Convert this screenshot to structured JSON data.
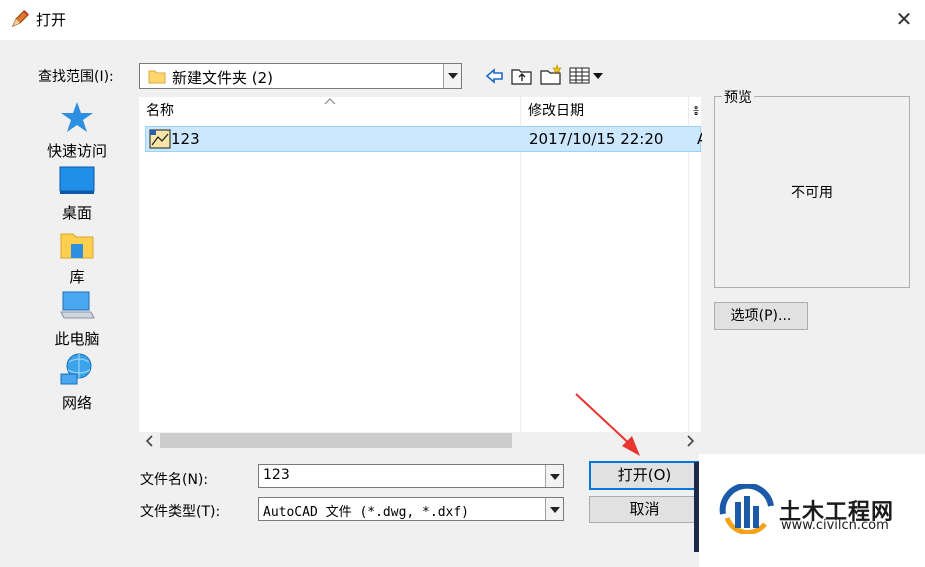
{
  "window": {
    "title": "打开",
    "close_symbol": "✕"
  },
  "lookin": {
    "label": "查找范围(I):",
    "value": "新建文件夹 (2)"
  },
  "toolbar": [
    "back-icon",
    "up-folder-icon",
    "new-folder-icon",
    "view-menu-icon"
  ],
  "places": [
    {
      "id": "quick-access",
      "label": "快速访问",
      "icon": "star-icon"
    },
    {
      "id": "desktop",
      "label": "桌面",
      "icon": "desktop-icon"
    },
    {
      "id": "library",
      "label": "库",
      "icon": "library-icon"
    },
    {
      "id": "this-pc",
      "label": "此电脑",
      "icon": "computer-icon"
    },
    {
      "id": "network",
      "label": "网络",
      "icon": "network-icon"
    }
  ],
  "filelist": {
    "columns": {
      "name": "名称",
      "modified": "修改日期",
      "extra": "៖"
    },
    "rows": [
      {
        "name": "123",
        "modified": "2017/10/15 22:20",
        "extra": "A",
        "selected": true
      }
    ]
  },
  "filename": {
    "label": "文件名(N):",
    "value": "123"
  },
  "filetype": {
    "label": "文件类型(T):",
    "value": "AutoCAD 文件 (*.dwg, *.dxf)"
  },
  "buttons": {
    "open": "打开(O)",
    "cancel": "取消",
    "options": "选项(P)..."
  },
  "preview": {
    "legend": "预览",
    "message": "不可用"
  },
  "watermark": {
    "brand": "土木工程网",
    "url": "www.civilcn.com"
  },
  "colors": {
    "accent": "#0078d7",
    "selection": "#cce8ff",
    "arrow": "#e8352f",
    "brand_blue": "#1b5aa8"
  }
}
